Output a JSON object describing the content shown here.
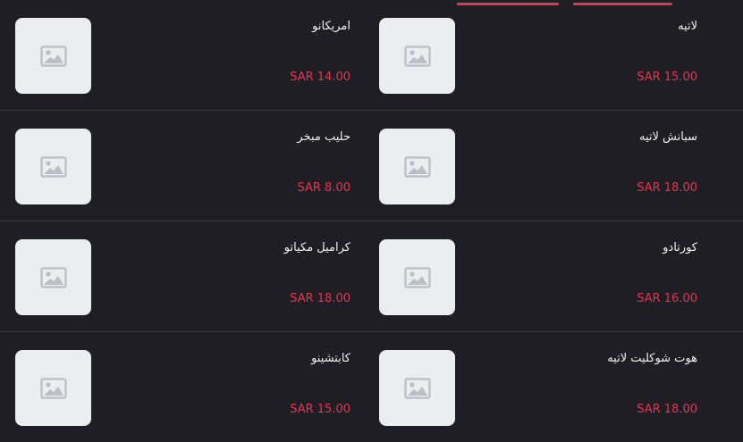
{
  "colors": {
    "background": "#1e1e24",
    "accent": "#e8334f",
    "thumb_bg": "#ebeef0",
    "divider": "#3a3a42",
    "text": "#f2f2f2"
  },
  "tabs": [
    {
      "label": "",
      "active": true
    },
    {
      "label": "",
      "active": true
    }
  ],
  "products": [
    {
      "name": "لاتيه",
      "price": "SAR 15.00",
      "image_icon": "image-placeholder-icon"
    },
    {
      "name": "امريكانو",
      "price": "SAR 14.00",
      "image_icon": "image-placeholder-icon"
    },
    {
      "name": "سبانش لاتيه",
      "price": "SAR 18.00",
      "image_icon": "image-placeholder-icon"
    },
    {
      "name": "حليب مبخر",
      "price": "SAR 8.00",
      "image_icon": "image-placeholder-icon"
    },
    {
      "name": "كورتادو",
      "price": "SAR 16.00",
      "image_icon": "image-placeholder-icon"
    },
    {
      "name": "كراميل مكياتو",
      "price": "SAR 18.00",
      "image_icon": "image-placeholder-icon"
    },
    {
      "name": "هوت شوكليت لاتيه",
      "price": "SAR 18.00",
      "image_icon": "image-placeholder-icon"
    },
    {
      "name": "كابتشينو",
      "price": "SAR 15.00",
      "image_icon": "image-placeholder-icon"
    }
  ]
}
